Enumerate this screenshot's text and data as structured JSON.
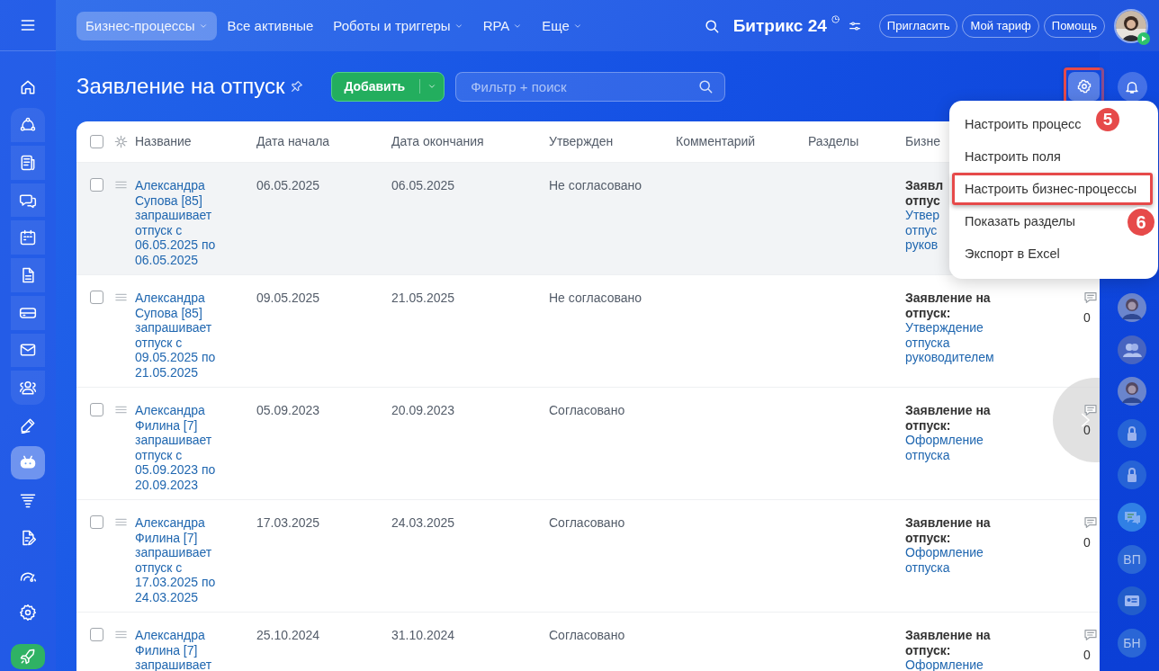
{
  "nav": {
    "tabs": [
      {
        "label": "Бизнес-процессы",
        "selected": true,
        "has_menu": true
      },
      {
        "label": "Все активные",
        "selected": false,
        "has_menu": false
      },
      {
        "label": "Роботы и триггеры",
        "selected": false,
        "has_menu": true
      },
      {
        "label": "RPA",
        "selected": false,
        "has_menu": true
      },
      {
        "label": "Еще",
        "selected": false,
        "has_menu": true
      }
    ],
    "logo": "Битрикс 24",
    "buttons": [
      "Пригласить",
      "Мой тариф",
      "Помощь"
    ]
  },
  "sidebar": {
    "items": [
      {
        "selected": false
      },
      {
        "selected": false
      },
      {
        "selected": false
      },
      {
        "selected": false
      },
      {
        "selected": false
      },
      {
        "selected": false
      },
      {
        "selected": false
      },
      {
        "selected": false
      },
      {
        "selected": false
      },
      {
        "selected": false
      },
      {
        "selected": true
      },
      {
        "selected": false
      },
      {
        "selected": false
      },
      {
        "selected": false
      },
      {
        "selected": false
      },
      {
        "selected": false
      }
    ]
  },
  "header": {
    "title": "Заявление на отпуск",
    "add_button": "Добавить",
    "search": {
      "placeholder": "Фильтр + поиск"
    },
    "settings_callout": "5"
  },
  "table": {
    "all_checked": false,
    "columns": [
      "Название",
      "Дата начала",
      "Дата окончания",
      "Утвержден",
      "Комментарий",
      "Разделы",
      "Бизне"
    ],
    "rows": [
      {
        "checked": false,
        "hovered": true,
        "name": "Александра Супова [85] запрашивает отпуск с 06.05.2025 по 06.05.2025",
        "start": "06.05.2025",
        "end": "06.05.2025",
        "approved": "Не согласовано",
        "process": {
          "title": "Заявл\nотпус",
          "link": "Утвер\nотпус\nруков"
        }
      },
      {
        "checked": false,
        "hovered": false,
        "name": "Александра Супова [85] запрашивает отпуск с 09.05.2025 по 21.05.2025",
        "start": "09.05.2025",
        "end": "21.05.2025",
        "approved": "Не согласовано",
        "process": {
          "title": "Заявление на отпуск:",
          "link": "Утверждение отпуска руководителем"
        },
        "comments": "0"
      },
      {
        "checked": false,
        "hovered": false,
        "name": "Александра Филина [7] запрашивает отпуск с 05.09.2023 по 20.09.2023",
        "start": "05.09.2023",
        "end": "20.09.2023",
        "approved": "Согласовано",
        "process": {
          "title": "Заявление на отпуск:",
          "link": "Оформление отпуска"
        },
        "comments": "0"
      },
      {
        "checked": false,
        "hovered": false,
        "name": "Александра Филина [7] запрашивает отпуск с 17.03.2025 по 24.03.2025",
        "start": "17.03.2025",
        "end": "24.03.2025",
        "approved": "Согласовано",
        "process": {
          "title": "Заявление на отпуск:",
          "link": "Оформление отпуска"
        },
        "comments": "0"
      },
      {
        "checked": false,
        "hovered": false,
        "name": "Александра Филина [7] запрашивает",
        "start": "25.10.2024",
        "end": "31.10.2024",
        "approved": "Согласовано",
        "process": {
          "title": "Заявление на отпуск:",
          "link": "Оформление"
        },
        "comments": "0"
      }
    ]
  },
  "menu": {
    "items": [
      {
        "label": "Настроить процесс"
      },
      {
        "label": "Настроить поля"
      },
      {
        "label": "Настроить бизнес-процессы",
        "callout": "6"
      },
      {
        "label": "Показать разделы"
      },
      {
        "label": "Экспорт в Excel"
      }
    ]
  },
  "right_bar": {
    "items": [
      {
        "kind": "picture"
      },
      {
        "kind": "group"
      },
      {
        "kind": "picture"
      },
      {
        "kind": "lock"
      },
      {
        "kind": "lock"
      },
      {
        "kind": "chat"
      },
      {
        "kind": "initials",
        "text": "ВП"
      },
      {
        "kind": "card"
      },
      {
        "kind": "initials",
        "text": "БН"
      }
    ]
  }
}
